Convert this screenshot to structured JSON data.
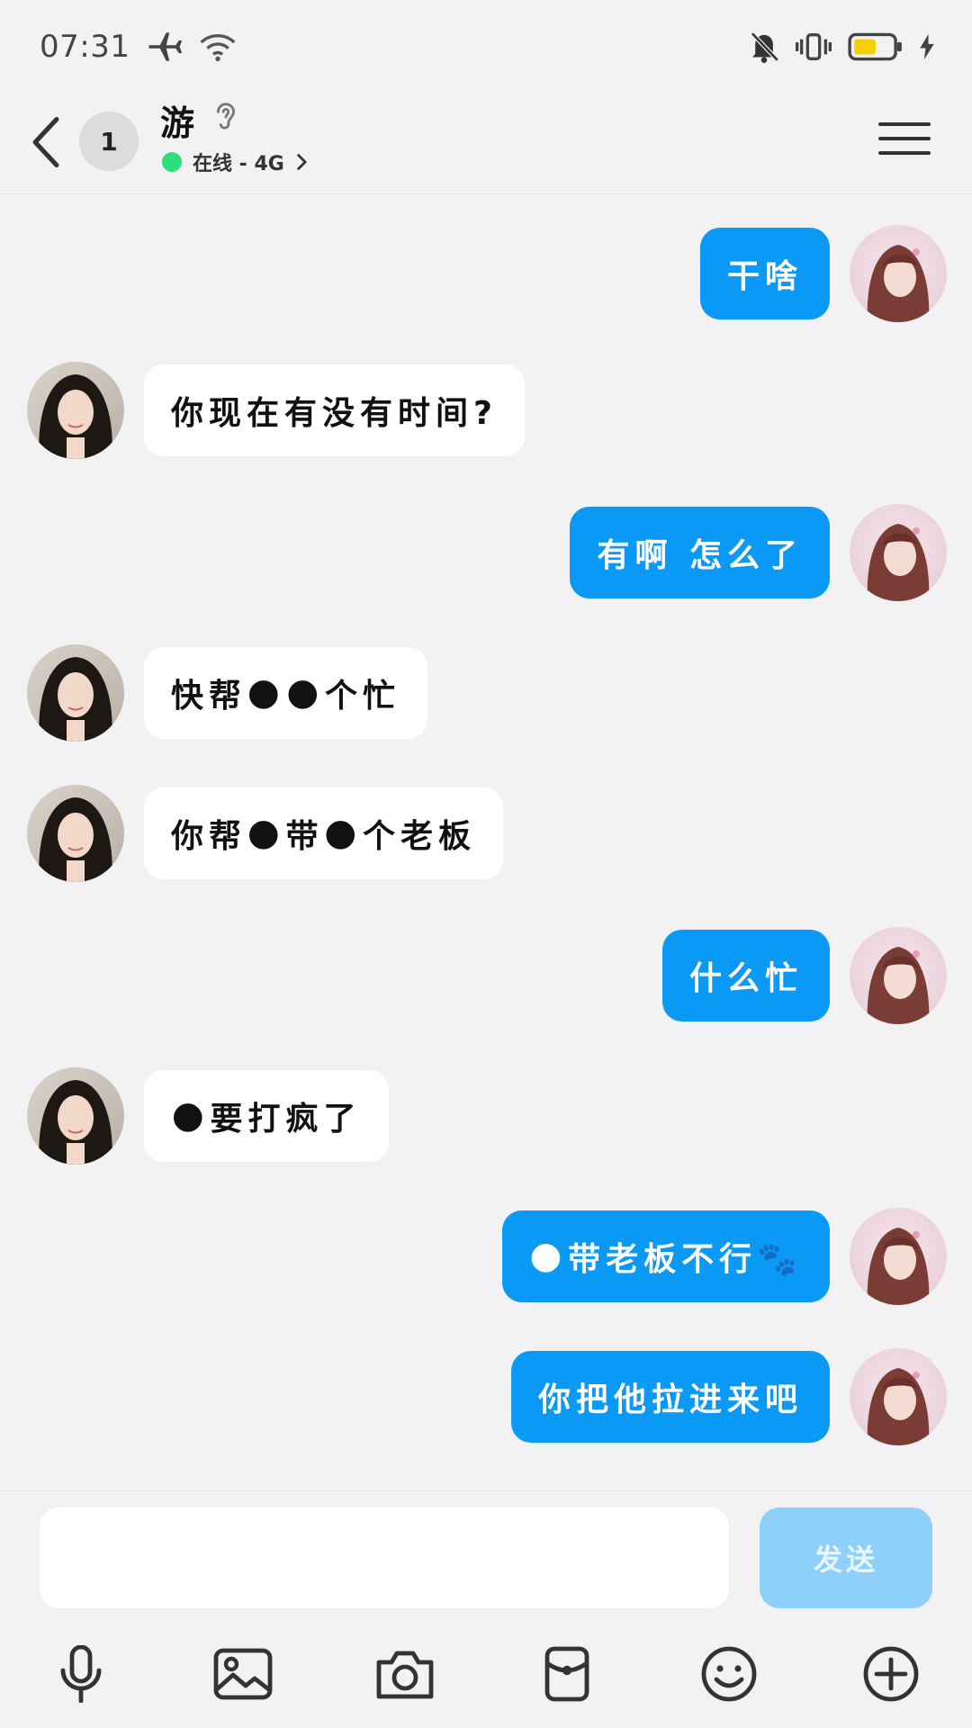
{
  "status_bar": {
    "time": "07:31"
  },
  "header": {
    "unread_count": "1",
    "contact_name": "游",
    "online_status": "在线 - 4G"
  },
  "messages": [
    {
      "direction": "out",
      "text": "干啥"
    },
    {
      "direction": "in",
      "text": "你现在有没有时间?"
    },
    {
      "direction": "out",
      "text": "有啊 怎么了"
    },
    {
      "direction": "in",
      "text": "快帮🌑🌑个忙"
    },
    {
      "direction": "in",
      "text": "你帮🌑带🌑个老板"
    },
    {
      "direction": "out",
      "text": "什么忙"
    },
    {
      "direction": "in",
      "text": "🌑要打疯了"
    },
    {
      "direction": "out",
      "text": "🌑带老板不行🐾"
    },
    {
      "direction": "out",
      "text": "你把他拉进来吧"
    }
  ],
  "composer": {
    "input_value": "",
    "send_label": "发送"
  },
  "toolbar": [
    "microphone-icon",
    "image-icon",
    "camera-icon",
    "red-packet-icon",
    "emoji-icon",
    "plus-icon"
  ],
  "colors": {
    "outgoing_bubble": "#0a99f5",
    "incoming_bubble": "#ffffff",
    "send_disabled": "#8fd0fb",
    "online": "#2ee07a"
  }
}
